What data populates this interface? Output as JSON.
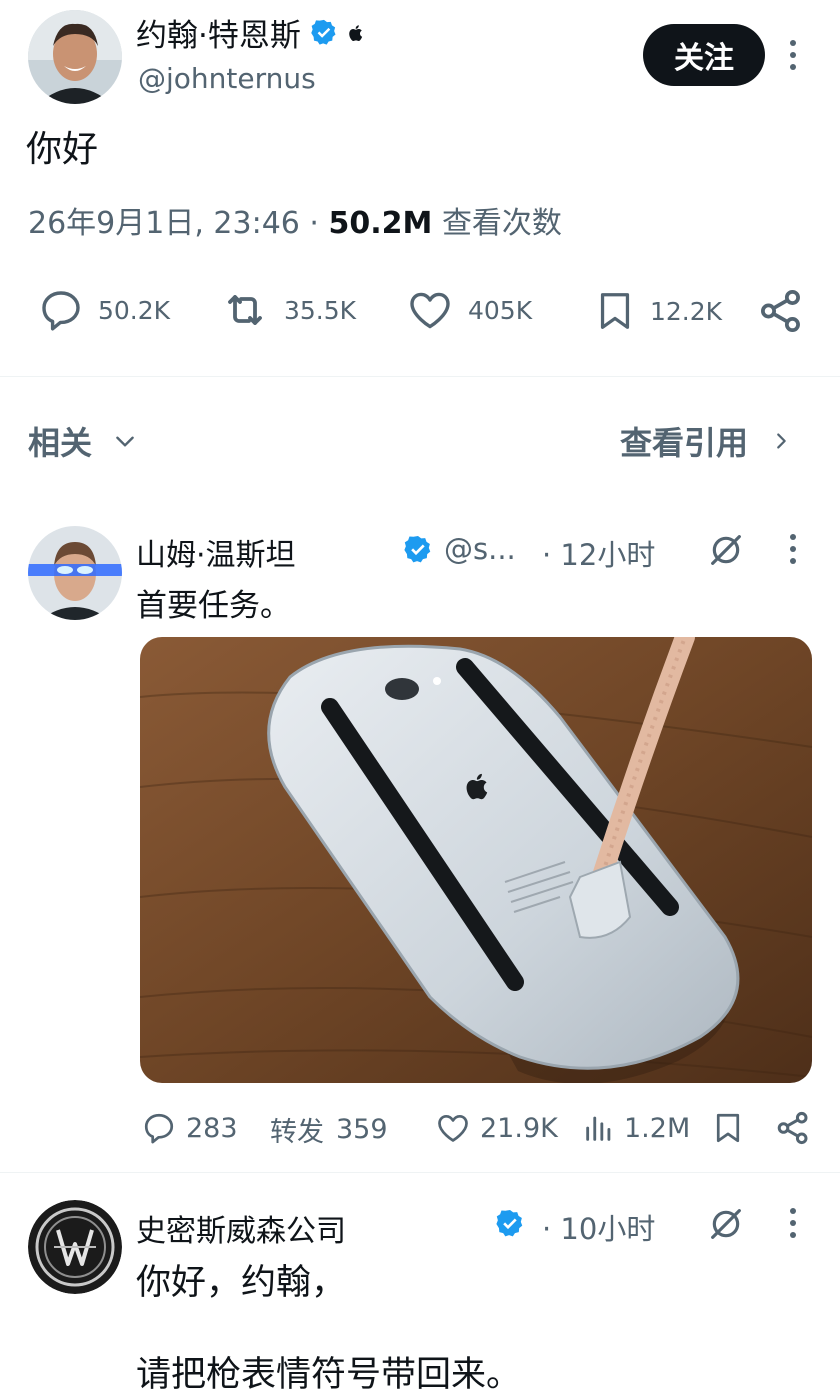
{
  "tweet": {
    "author_name": "约翰·特恩斯",
    "handle": "@johnternus",
    "follow_label": "关注",
    "text": "你好",
    "date": "26年9月1日, 23:46",
    "separator": "·",
    "views_count": "50.2M",
    "views_label": "查看次数",
    "replies": "50.2K",
    "retweets": "35.5K",
    "likes": "405K",
    "bookmarks": "12.2K",
    "icons": [
      "verified-badge-icon",
      "apple-logo-icon",
      "more-icon",
      "reply-icon",
      "retweet-icon",
      "like-icon",
      "bookmark-icon",
      "share-icon"
    ]
  },
  "related_bar": {
    "related_label": "相关",
    "view_quotes_label": "查看引用"
  },
  "replies": [
    {
      "name": "山姆·温斯坦",
      "handle": "@s...",
      "time": "· 12小时",
      "text": "首要任务。",
      "stats": {
        "replies": "283",
        "retweet_label": "转发",
        "retweets": "359",
        "likes": "21.9K",
        "views": "1.2M"
      }
    },
    {
      "name": "史密斯威森公司",
      "time": "· 10小时",
      "text_line1": "你好，约翰，",
      "text_line2": "请把枪表情符号带回来。"
    }
  ],
  "colors": {
    "verified_blue": "#1d9bf0",
    "text_primary": "#0f1419",
    "text_secondary": "#536471",
    "follow_button_bg": "#0f1419"
  }
}
